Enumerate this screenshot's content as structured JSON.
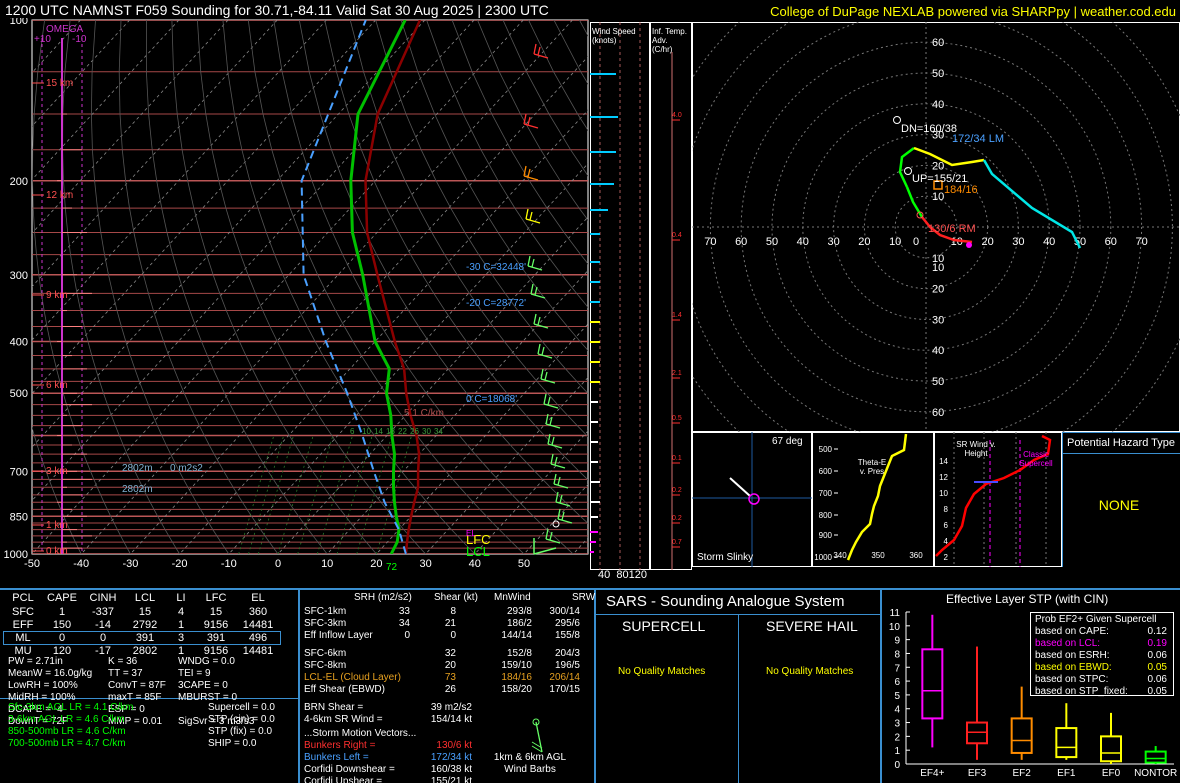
{
  "header": {
    "title": "1200 UTC NAMNST F059 Sounding for 30.71,-84.11 Valid  Sat 30 Aug 2025 | 2300 UTC",
    "credit": "College of DuPage NEXLAB powered via SHARPpy | weather.cod.edu"
  },
  "skewt": {
    "pressure_labels": [
      "100",
      "200",
      "300",
      "400",
      "500",
      "700",
      "850",
      "1000"
    ],
    "temp_labels": [
      "-50",
      "-40",
      "-30",
      "-20",
      "-10",
      "0",
      "10",
      "20",
      "30",
      "40",
      "50"
    ],
    "height_labels": [
      "15 km",
      "12 km",
      "9 km",
      "6 km",
      "3 km",
      "1 km",
      "0 km"
    ],
    "omega_title": "OMEGA",
    "omega_ticks": [
      "+10",
      "-10"
    ],
    "annotations": [
      "-30 C=32448'",
      "-20 C=28772'",
      "0 C=18068'",
      "5.1 C/km",
      "2802m",
      "0 m2s2",
      "2802m",
      "72",
      "LFC",
      "LCL",
      "EL"
    ],
    "lapse_ticks": [
      "6",
      "10",
      "14",
      "18",
      "22",
      "26",
      "30",
      "34"
    ]
  },
  "chart_data": [
    {
      "type": "line",
      "title": "Skew-T",
      "series": [
        {
          "name": "Temperature",
          "color": "#8b0000",
          "points": [
            [
              100,
              -71
            ],
            [
              150,
              -62
            ],
            [
              200,
              -52
            ],
            [
              250,
              -42
            ],
            [
              300,
              -32
            ],
            [
              400,
              -16
            ],
            [
              450,
              -9
            ],
            [
              500,
              -4
            ],
            [
              550,
              1
            ],
            [
              600,
              6
            ],
            [
              650,
              10
            ],
            [
              700,
              13
            ],
            [
              750,
              16
            ],
            [
              800,
              18
            ],
            [
              850,
              20
            ],
            [
              900,
              22
            ],
            [
              950,
              24
            ],
            [
              1000,
              26
            ]
          ]
        },
        {
          "name": "Dewpoint",
          "color": "#00c000",
          "points": [
            [
              100,
              -74
            ],
            [
              150,
              -66
            ],
            [
              200,
              -55
            ],
            [
              250,
              -45
            ],
            [
              300,
              -35
            ],
            [
              400,
              -20
            ],
            [
              450,
              -12
            ],
            [
              500,
              -8
            ],
            [
              550,
              -3
            ],
            [
              600,
              1
            ],
            [
              650,
              5
            ],
            [
              700,
              8
            ],
            [
              750,
              11
            ],
            [
              800,
              14
            ],
            [
              850,
              17
            ],
            [
              900,
              20
            ],
            [
              950,
              22
            ],
            [
              1000,
              23
            ]
          ]
        },
        {
          "name": "Parcel",
          "color": "#4aa0ff",
          "points": [
            [
              1000,
              26
            ],
            [
              900,
              20
            ],
            [
              800,
              12
            ],
            [
              700,
              4
            ],
            [
              600,
              -5
            ],
            [
              500,
              -16
            ],
            [
              400,
              -30
            ],
            [
              300,
              -47
            ],
            [
              200,
              -65
            ],
            [
              100,
              -82
            ]
          ]
        }
      ],
      "ylim": [
        1000,
        100
      ]
    },
    {
      "type": "scatter",
      "title": "Hodograph",
      "axis_ticks": [
        "10",
        "20",
        "30",
        "40",
        "50",
        "60",
        "70"
      ],
      "labels": [
        "DN=160/38",
        "172/34 LM",
        "UP=155/21",
        "184/16",
        "130/6 RM"
      ]
    },
    {
      "type": "bar",
      "title": "Effective Layer STP (with CIN)",
      "categories": [
        "EF4+",
        "EF3",
        "EF2",
        "EF1",
        "EF0",
        "NONTOR"
      ],
      "ylim": [
        0,
        11
      ],
      "y_ticks": [
        "0",
        "1",
        "2",
        "3",
        "4",
        "5",
        "6",
        "7",
        "8",
        "9",
        "10",
        "11"
      ],
      "boxes": [
        {
          "name": "EF4+",
          "low": 1.2,
          "q1": 3.3,
          "median": 5.3,
          "q3": 8.3,
          "high": 10.8,
          "color": "#ff00ff"
        },
        {
          "name": "EF3",
          "low": 0.3,
          "q1": 1.5,
          "median": 2.3,
          "q3": 3.0,
          "high": 8.5,
          "color": "#ff2020"
        },
        {
          "name": "EF2",
          "low": 0.3,
          "q1": 0.8,
          "median": 1.7,
          "q3": 3.3,
          "high": 5.6,
          "color": "#ff8c00"
        },
        {
          "name": "EF1",
          "low": 0.3,
          "q1": 0.5,
          "median": 1.2,
          "q3": 2.6,
          "high": 4.4,
          "color": "#ffff00"
        },
        {
          "name": "EF0",
          "low": 0.0,
          "q1": 0.2,
          "median": 0.8,
          "q3": 2.0,
          "high": 3.7,
          "color": "#ffff00"
        },
        {
          "name": "NONTOR",
          "low": 0.0,
          "q1": 0.1,
          "median": 0.4,
          "q3": 0.9,
          "high": 1.3,
          "color": "#00ff00"
        }
      ]
    }
  ],
  "wind_speed_panel": {
    "title": "Wind Speed (knots)",
    "ticks": [
      "40",
      "80",
      "120"
    ]
  },
  "temp_adv_panel": {
    "title": "Inf. Temp. Adv. (C/hr)",
    "values": [
      "4.0",
      "0.4",
      "1.4",
      "2.1",
      "0.5",
      "0.1",
      "0.2",
      "0.2",
      "0.7"
    ]
  },
  "storm_slinky": {
    "title": "Storm Slinky",
    "deg": "67 deg"
  },
  "theta_panel": {
    "title": "Theta-E v. Pres",
    "ticks_y": [
      "500",
      "600",
      "700",
      "800",
      "900",
      "1000"
    ],
    "ticks_x": [
      "340",
      "350",
      "360"
    ]
  },
  "srwind_panel": {
    "title": "SR Wind v. Height",
    "label": "Classic Supercell",
    "ticks_y": [
      "14",
      "12",
      "10",
      "8",
      "6",
      "4",
      "2"
    ]
  },
  "hazard": {
    "title": "Potential Hazard Type",
    "value": "NONE"
  },
  "parcel_table": {
    "headers": [
      "PCL",
      "CAPE",
      "CINH",
      "LCL",
      "LI",
      "LFC",
      "EL"
    ],
    "rows": [
      [
        "SFC",
        "1",
        "-337",
        "15",
        "4",
        "15",
        "360"
      ],
      [
        "EFF",
        "150",
        "-14",
        "2792",
        "1",
        "9156",
        "14481"
      ],
      [
        "ML",
        "0",
        "0",
        "391",
        "3",
        "391",
        "496"
      ],
      [
        "MU",
        "120",
        "-17",
        "2802",
        "1",
        "9156",
        "14481"
      ]
    ]
  },
  "indices": [
    [
      "PW = 2.71in",
      "K = 36",
      "WNDG = 0.0"
    ],
    [
      "MeanW = 16.0g/kg",
      "TT = 37",
      "TEI = 9"
    ],
    [
      "LowRH = 100%",
      "ConvT = 87F",
      "3CAPE = 0"
    ],
    [
      "MidRH = 100%",
      "maxT = 85F",
      "MBURST = 0"
    ],
    [
      "DCAPE = -4",
      "ESP = 0",
      ""
    ],
    [
      "DownT = 72F",
      "MMP = 0.01",
      "SigSvr = 3 m3/s3"
    ]
  ],
  "lapse_rates": [
    "Sfc-3km AGL LR = 4.1 C/km",
    "3-6km AGL LR = 4.6 C/km",
    "850-500mb LR = 4.6 C/km",
    "700-500mb LR = 4.7 C/km"
  ],
  "composite": [
    "Supercell = 0.0",
    "STP (cin) = 0.0",
    "STP (fix) = 0.0",
    "SHIP = 0.0"
  ],
  "kinematics": {
    "headers": [
      "SRH (m2/s2)",
      "Shear (kt)",
      "MnWind",
      "SRW"
    ],
    "rows": [
      [
        "SFC-1km",
        "33",
        "8",
        "293/8",
        "300/14"
      ],
      [
        "SFC-3km",
        "34",
        "21",
        "186/2",
        "295/6"
      ],
      [
        "Eff Inflow Layer",
        "0",
        "0",
        "144/14",
        "155/8"
      ],
      [
        "SFC-6km",
        "32",
        "152/8",
        "204/3",
        ""
      ],
      [
        "SFC-8km",
        "20",
        "159/10",
        "196/5",
        ""
      ],
      [
        "LCL-EL (Cloud Layer)",
        "73",
        "184/16",
        "206/14",
        ""
      ],
      [
        "Eff Shear (EBWD)",
        "26",
        "158/20",
        "170/15",
        ""
      ]
    ],
    "brn_shear": "BRN Shear =",
    "brn_shear_val": "39 m2/s2",
    "sr_wind": "4-6km SR Wind =",
    "sr_wind_val": "154/14 kt",
    "storm_motion_title": "...Storm Motion Vectors...",
    "motions": [
      [
        "Bunkers Right =",
        "130/6 kt"
      ],
      [
        "Bunkers Left =",
        "172/34 kt"
      ],
      [
        "Corfidi Downshear =",
        "160/38 kt"
      ],
      [
        "Corfidi Upshear =",
        "155/21 kt"
      ]
    ],
    "barb_label": "1km & 6km AGL Wind Barbs"
  },
  "sars": {
    "title": "SARS - Sounding Analogue System",
    "supercell": "SUPERCELL",
    "hail": "SEVERE HAIL",
    "nomatch1": "No Quality Matches",
    "nomatch2": "No Quality Matches"
  },
  "stp_legend": {
    "title": "Prob EF2+ Given Supercell",
    "rows": [
      [
        "based on CAPE:",
        "0.12",
        "#ffffff"
      ],
      [
        "based on LCL:",
        "0.19",
        "#ff00ff"
      ],
      [
        "based on ESRH:",
        "0.06",
        "#ffffff"
      ],
      [
        "based on EBWD:",
        "0.05",
        "#ffff00"
      ],
      [
        "based on STPC:",
        "0.06",
        "#ffffff"
      ],
      [
        "based on STP_fixed:",
        "0.05",
        "#ffffff"
      ]
    ]
  }
}
